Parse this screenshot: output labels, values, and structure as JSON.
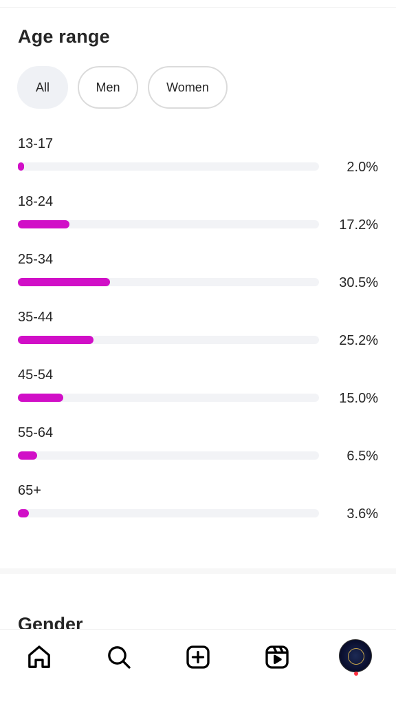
{
  "age_range": {
    "title": "Age range",
    "filters": [
      {
        "label": "All",
        "selected": true
      },
      {
        "label": "Men",
        "selected": false
      },
      {
        "label": "Women",
        "selected": false
      }
    ],
    "bar_color": "#d10fc7",
    "track_color": "#f2f3f6",
    "rows": [
      {
        "label": "13-17",
        "percent_text": "2.0%",
        "value": 2.0
      },
      {
        "label": "18-24",
        "percent_text": "17.2%",
        "value": 17.2
      },
      {
        "label": "25-34",
        "percent_text": "30.5%",
        "value": 30.5
      },
      {
        "label": "35-44",
        "percent_text": "25.2%",
        "value": 25.2
      },
      {
        "label": "45-54",
        "percent_text": "15.0%",
        "value": 15.0
      },
      {
        "label": "55-64",
        "percent_text": "6.5%",
        "value": 6.5
      },
      {
        "label": "65+",
        "percent_text": "3.6%",
        "value": 3.6
      }
    ]
  },
  "gender": {
    "title": "Gender"
  },
  "bottom_nav": {
    "items": [
      {
        "icon": "home-icon"
      },
      {
        "icon": "search-icon"
      },
      {
        "icon": "create-icon"
      },
      {
        "icon": "reels-icon"
      },
      {
        "icon": "profile-avatar"
      }
    ],
    "notification_dot_color": "#ff3040"
  }
}
